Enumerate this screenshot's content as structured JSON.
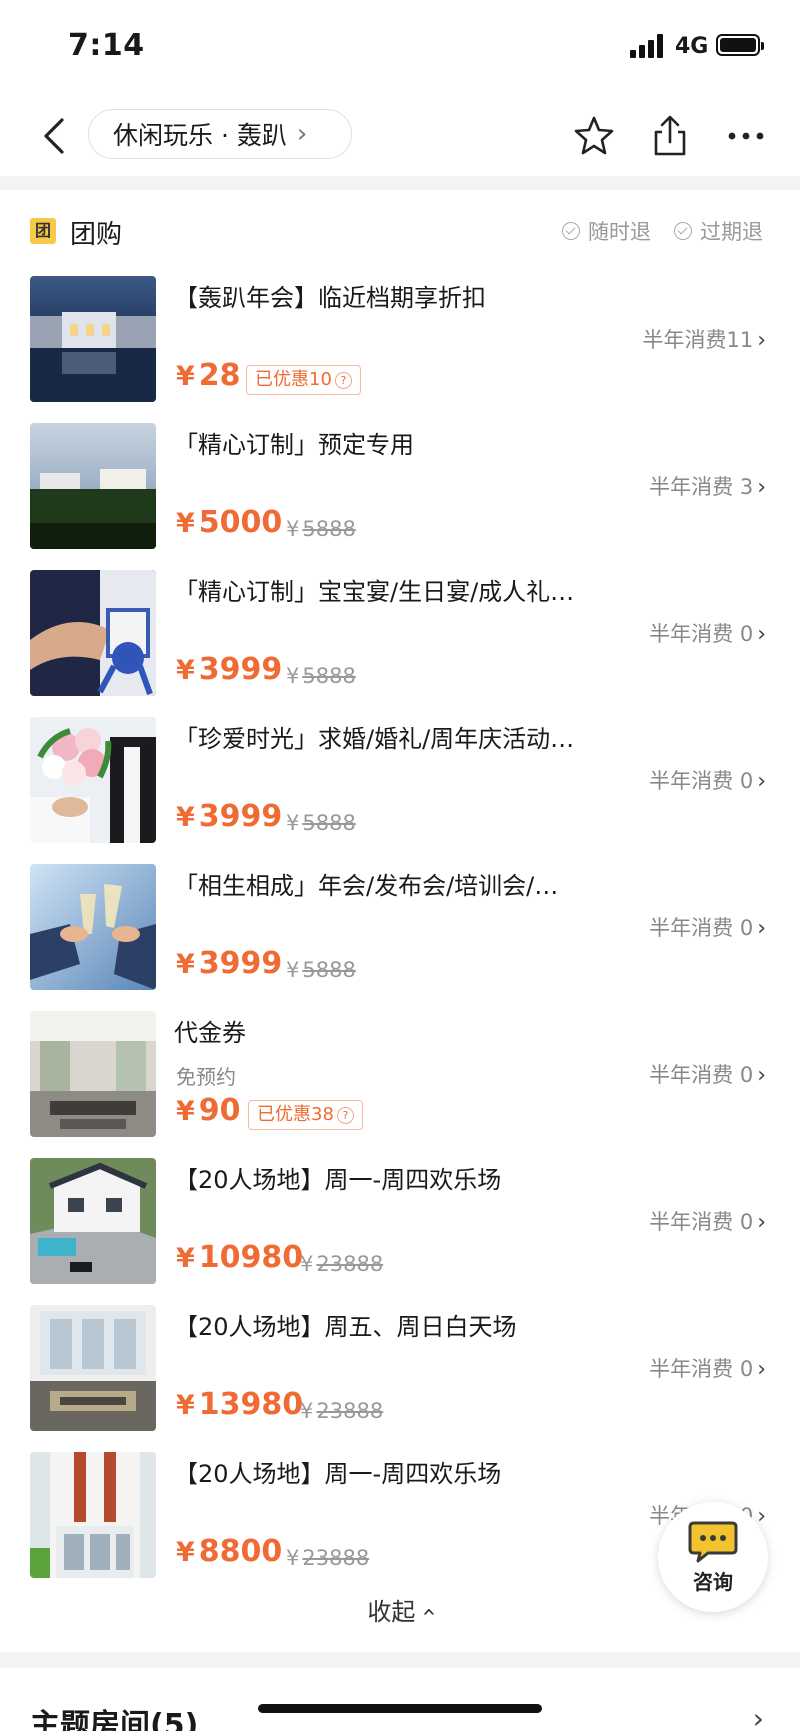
{
  "status": {
    "time": "7:14",
    "network": "4G"
  },
  "nav": {
    "breadcrumb": "休闲玩乐 · 轰趴"
  },
  "section": {
    "badge": "团",
    "title": "团购",
    "policy1": "随时退",
    "policy2": "过期退"
  },
  "deals": [
    {
      "title": "【轰趴年会】临近档期享折扣",
      "sub": "",
      "sales": "半年消费11",
      "price": "28",
      "orig": "",
      "discount": "已优惠10"
    },
    {
      "title": "「精心订制」预定专用",
      "sub": "",
      "sales": "半年消费 3",
      "price": "5000",
      "orig": "5888",
      "discount": ""
    },
    {
      "title": "「精心订制」宝宝宴/生日宴/成人礼…",
      "sub": "",
      "sales": "半年消费 0",
      "price": "3999",
      "orig": "5888",
      "discount": ""
    },
    {
      "title": "「珍爱时光」求婚/婚礼/周年庆活动…",
      "sub": "",
      "sales": "半年消费 0",
      "price": "3999",
      "orig": "5888",
      "discount": ""
    },
    {
      "title": "「相生相成」年会/发布会/培训会/…",
      "sub": "",
      "sales": "半年消费 0",
      "price": "3999",
      "orig": "5888",
      "discount": ""
    },
    {
      "title": "代金券",
      "sub": "免预约",
      "sales": "半年消费 0",
      "price": "90",
      "orig": "",
      "discount": "已优惠38"
    },
    {
      "title": "【20人场地】周一-周四欢乐场",
      "sub": "",
      "sales": "半年消费 0",
      "price": "10980",
      "orig": "23888",
      "discount": ""
    },
    {
      "title": "【20人场地】周五、周日白天场",
      "sub": "",
      "sales": "半年消费 0",
      "price": "13980",
      "orig": "23888",
      "discount": ""
    },
    {
      "title": "【20人场地】周一-周四欢乐场",
      "sub": "",
      "sales": "半年消费 0",
      "price": "8800",
      "orig": "23888",
      "discount": ""
    }
  ],
  "collapse": "收起",
  "consult": "咨询",
  "theme_rooms": "主题房间(5)",
  "currency": "¥",
  "colors": {
    "price": "#ef6b33",
    "badge": "#f7c948"
  }
}
